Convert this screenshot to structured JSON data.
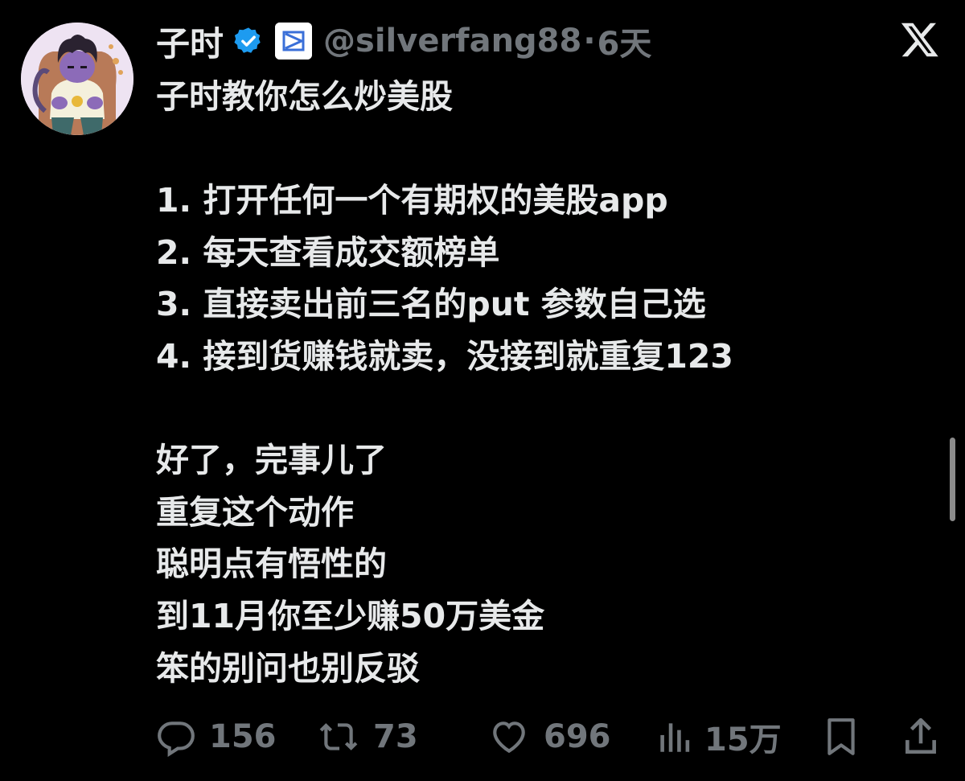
{
  "post": {
    "display_name": "子时",
    "handle": "@silverfang88",
    "separator": "·",
    "time": "6天",
    "lines": [
      "子时教你怎么炒美股",
      "",
      "1. 打开任何一个有期权的美股app",
      "2. 每天查看成交额榜单",
      "3. 直接卖出前三名的put 参数自己选",
      "4. 接到货赚钱就卖，没接到就重复123",
      "",
      "好了，完事儿了",
      "重复这个动作",
      "聪明点有悟性的",
      "到11月你至少赚50万美金",
      "笨的别问也别反驳"
    ]
  },
  "actions": {
    "replies": "156",
    "reposts": "73",
    "likes": "696",
    "views": "15万"
  },
  "icons": {
    "verified": "verified-badge-icon",
    "affiliate": "affiliate-badge-icon",
    "brand": "x-logo-icon",
    "reply": "reply-icon",
    "repost": "repost-icon",
    "like": "heart-icon",
    "views": "views-chart-icon",
    "bookmark": "bookmark-icon",
    "share": "share-icon"
  },
  "colors": {
    "background": "#000000",
    "text": "#e7e9ea",
    "secondary": "#71767b",
    "verified": "#1d9bf0"
  }
}
